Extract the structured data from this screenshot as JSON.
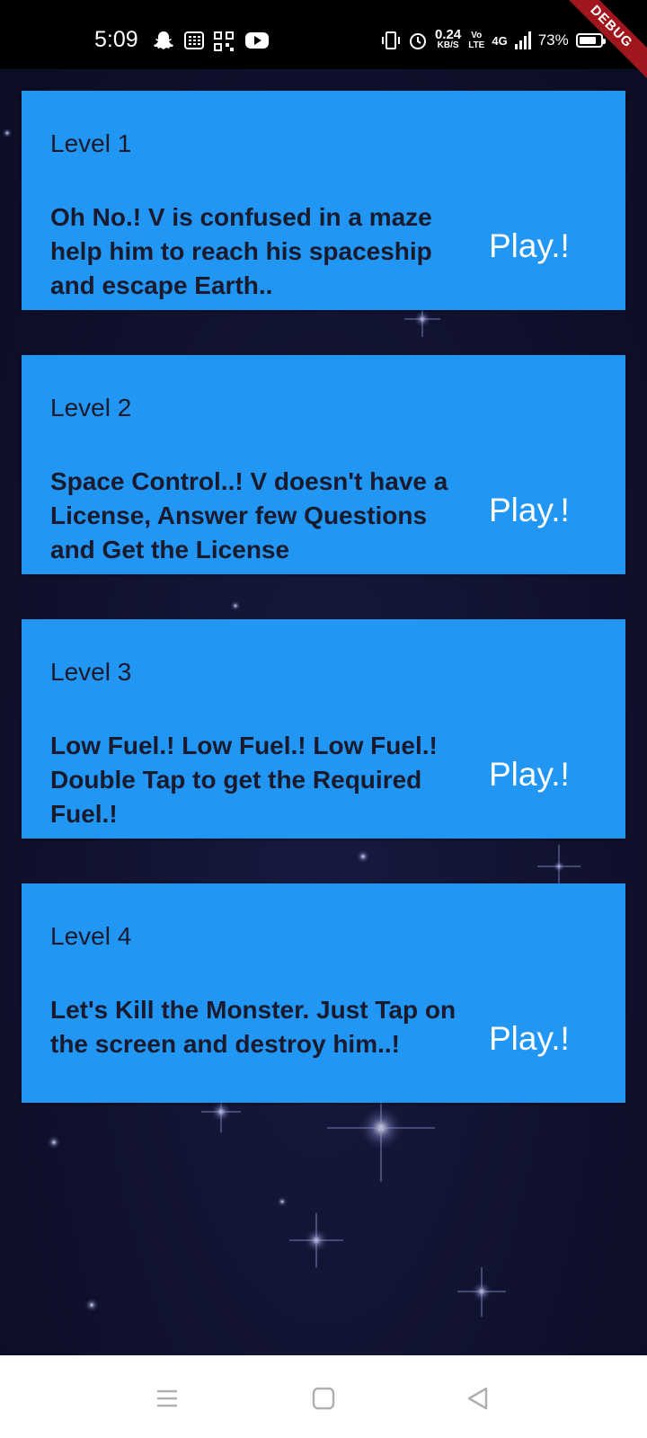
{
  "status_bar": {
    "time": "5:09",
    "net_speed_value": "0.24",
    "net_speed_unit": "KB/S",
    "volte_top": "Vo",
    "volte_bottom": "LTE",
    "network": "4G",
    "battery_percent": "73%",
    "battery_level": 0.73,
    "icons": [
      "snapchat-icon",
      "calculator-icon",
      "qr-scan-icon",
      "youtube-icon",
      "vibrate-icon",
      "alarm-icon",
      "signal-icon",
      "battery-icon"
    ]
  },
  "debug_banner": "DEBUG",
  "levels": [
    {
      "title": "Level 1",
      "description": "Oh No.! V is confused in a maze help him to reach his spaceship and escape Earth..",
      "play_label": "Play.!"
    },
    {
      "title": "Level 2",
      "description": "Space Control..! V doesn't have a License, Answer few Questions and Get the License",
      "play_label": "Play.!"
    },
    {
      "title": "Level 3",
      "description": "Low Fuel.! Low Fuel.! Low Fuel.! Double Tap to get the Required Fuel.!",
      "play_label": "Play.!"
    },
    {
      "title": "Level 4",
      "description": "Let's Kill the Monster. Just Tap on the screen and destroy him..!",
      "play_label": "Play.!"
    }
  ],
  "nav_bar": {
    "icons": [
      "menu-icon",
      "home-icon",
      "back-icon"
    ]
  },
  "colors": {
    "card": "#2196f3",
    "background": "#10122e",
    "card_text": "#1a1a2e",
    "play_text": "#ffffff"
  }
}
